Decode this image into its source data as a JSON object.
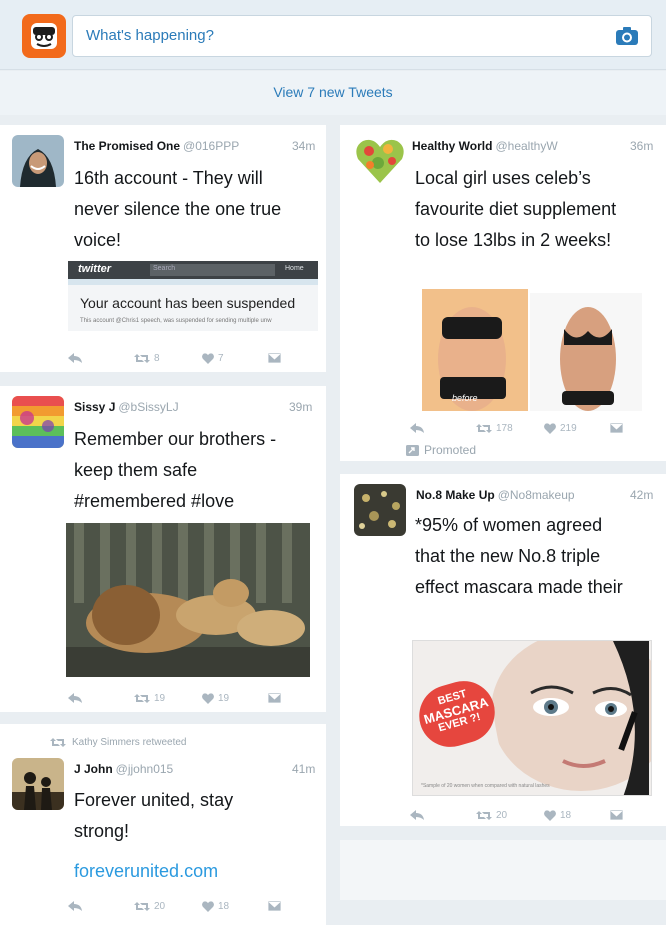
{
  "compose": {
    "placeholder": "What's happening?",
    "avatar_icon": "user-avatar-icon",
    "camera_icon": "camera-icon"
  },
  "new_tweets": "View 7 new Tweets",
  "colors": {
    "link": "#2b7bb9",
    "muted": "#9aa6af",
    "bg": "#e9eef2",
    "avatar_me": "#f26a1b"
  },
  "tweets": [
    {
      "name": "The Promised One",
      "handle": "@016PPP",
      "time": "34m",
      "lines": [
        "16th account - They will",
        "never silence the one true",
        "voice!"
      ],
      "media": {
        "brand": "twitter",
        "search": "Search",
        "home": "Home",
        "headline": "Your account has been suspended",
        "sub": "This account @Chris1 speech, was suspended for sending multiple unw"
      },
      "retweets": "8",
      "likes": "7"
    },
    {
      "name": "Sissy J",
      "handle": "@bSissyLJ",
      "time": "39m",
      "lines": [
        "Remember our brothers -",
        "keep them safe",
        "#remembered #love"
      ],
      "retweets": "19",
      "likes": "19"
    },
    {
      "retweeted_by": "Kathy Simmers retweeted",
      "name": "J John",
      "handle": "@jjohn015",
      "time": "41m",
      "lines": [
        "Forever united, stay",
        "strong!"
      ],
      "link": "foreverunited.com",
      "retweets": "20",
      "likes": "18"
    },
    {
      "name": "Healthy World",
      "handle": "@healthyW",
      "time": "36m",
      "lines": [
        "Local girl uses celeb’s",
        "favourite diet supplement",
        "to lose 13lbs in 2 weeks!"
      ],
      "media_caption": "before",
      "retweets": "178",
      "likes": "219",
      "promoted": "Promoted"
    },
    {
      "name": "No.8 Make Up",
      "handle": "@No8makeup",
      "time": "42m",
      "lines": [
        "*95% of women agreed",
        "that the new No.8 triple",
        "effect mascara made their"
      ],
      "badge": [
        "BEST",
        "MASCARA",
        "EVER ?!"
      ],
      "footnote": "*Sample of 20 women when compared with natural lashes",
      "retweets": "20",
      "likes": "18"
    }
  ]
}
